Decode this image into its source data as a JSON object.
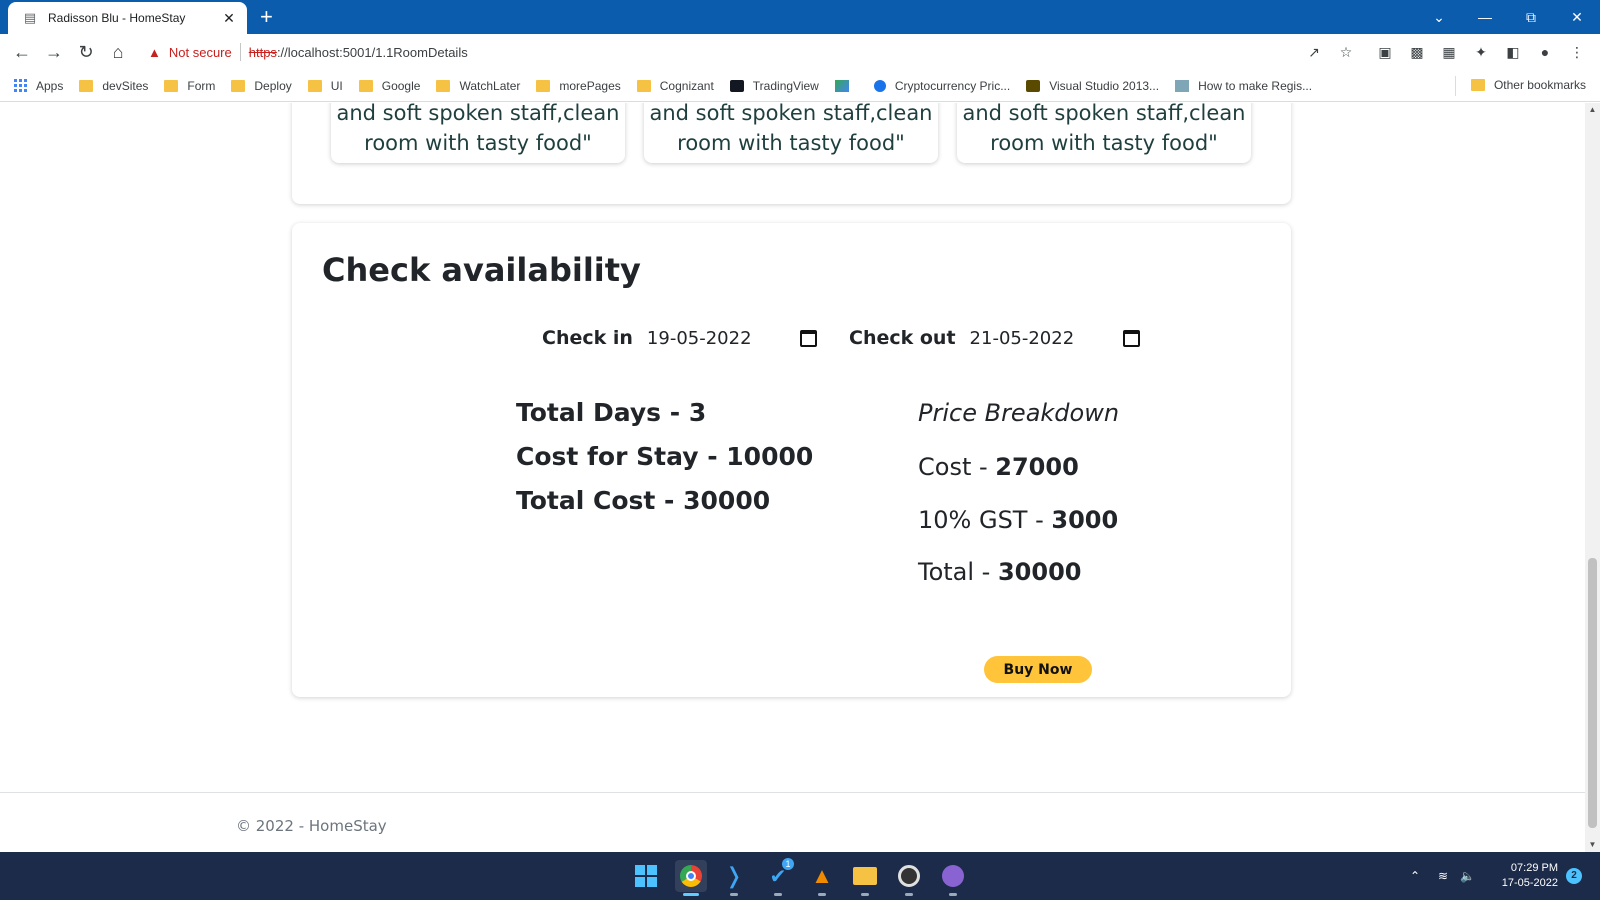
{
  "browser": {
    "tab_title": "Radisson Blu - HomeStay",
    "tab_favicon": "document-icon",
    "new_tab": "+",
    "security_label": "Not secure",
    "url_scheme": "https",
    "url_rest": "://localhost:5001/1.1RoomDetails"
  },
  "bookmarks": {
    "items": [
      {
        "label": "Apps",
        "icon": "apps-grid-icon"
      },
      {
        "label": "devSites",
        "icon": "folder-icon"
      },
      {
        "label": "Form",
        "icon": "folder-icon"
      },
      {
        "label": "Deploy",
        "icon": "folder-icon"
      },
      {
        "label": "UI",
        "icon": "folder-icon"
      },
      {
        "label": "Google",
        "icon": "folder-icon"
      },
      {
        "label": "WatchLater",
        "icon": "folder-icon"
      },
      {
        "label": "morePages",
        "icon": "folder-icon"
      },
      {
        "label": "Cognizant",
        "icon": "folder-icon"
      },
      {
        "label": "TradingView",
        "icon": "tradingview-icon"
      },
      {
        "label": "",
        "icon": "chart-bookmark-icon"
      },
      {
        "label": "Cryptocurrency Pric...",
        "icon": "coin-icon"
      },
      {
        "label": "Visual Studio 2013...",
        "icon": "g-site-icon"
      },
      {
        "label": "How to make Regis...",
        "icon": "site-icon"
      }
    ],
    "other": "Other bookmarks"
  },
  "reviews": [
    {
      "line1": "and soft spoken staff,clean",
      "line2": "room with tasty food\""
    },
    {
      "line1": "and soft spoken staff,clean",
      "line2": "room with tasty food\""
    },
    {
      "line1": "and soft spoken staff,clean",
      "line2": "room with tasty food\""
    }
  ],
  "availability": {
    "title": "Check availability",
    "checkin_label": "Check in",
    "checkin_value": "19-05-2022",
    "checkout_label": "Check out",
    "checkout_value": "21-05-2022",
    "total_days": "Total Days - 3",
    "cost_for_stay": "Cost for Stay - 10000",
    "total_cost": "Total Cost - 30000",
    "price_breakdown_title": "Price Breakdown",
    "cost_label": "Cost - ",
    "cost_value": "27000",
    "gst_label": "10% GST - ",
    "gst_value": "3000",
    "total_label": "Total - ",
    "total_value": "30000",
    "buy_label": "Buy Now",
    "buy_color": "#ffc439"
  },
  "footer": {
    "text": "© 2022 - HomeStay"
  },
  "taskbar": {
    "time": "07:29 PM",
    "date": "17-05-2022",
    "notifications": "2",
    "badge": "1"
  },
  "colors": {
    "titlebar": "#0b5cad",
    "taskbar": "#1c2b4a",
    "warning": "#c5221f"
  }
}
